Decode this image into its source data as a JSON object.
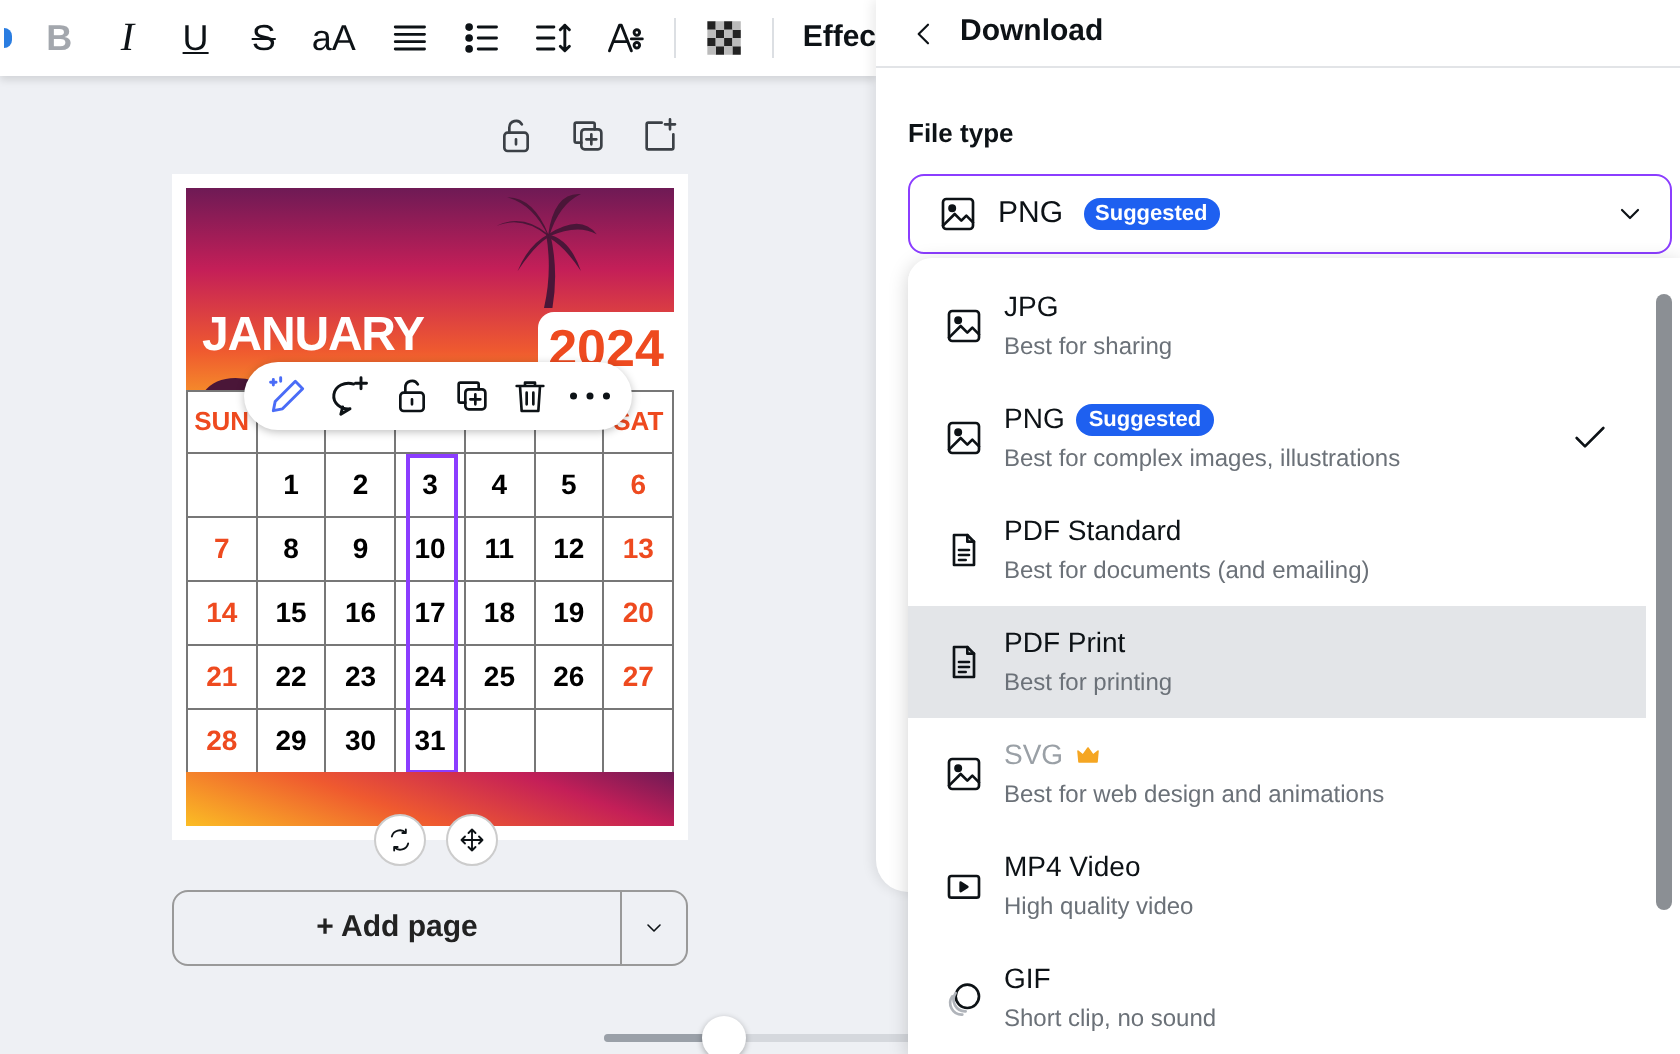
{
  "toolbar": {
    "items": [
      {
        "kind": "glyph",
        "text": "B",
        "disabled": true
      },
      {
        "kind": "glyph",
        "text": "I",
        "disabled": false
      },
      {
        "kind": "glyph",
        "text": "U",
        "disabled": false
      },
      {
        "kind": "glyph",
        "text": "S",
        "disabled": false
      },
      {
        "kind": "glyph",
        "text": "aA",
        "disabled": false
      },
      {
        "kind": "align"
      },
      {
        "kind": "list"
      },
      {
        "kind": "spacing"
      },
      {
        "kind": "textfx"
      },
      {
        "kind": "transparency"
      }
    ],
    "effects_label": "Effec"
  },
  "calendar": {
    "month": "JANUARY",
    "year": "2024",
    "headers": {
      "sun": "SUN",
      "sat": "SAT"
    },
    "weeks": [
      [
        {
          "kind": "blank"
        },
        {
          "kind": "weekday",
          "text": "1",
          "selected": false
        },
        {
          "kind": "weekday",
          "text": "2",
          "selected": false
        },
        {
          "kind": "weekday",
          "text": "3",
          "selected": true
        },
        {
          "kind": "weekday",
          "text": "4",
          "selected": false
        },
        {
          "kind": "weekday",
          "text": "5",
          "selected": false
        },
        {
          "kind": "weekend",
          "text": "6",
          "selected": false
        }
      ],
      [
        {
          "kind": "weekend",
          "text": "7",
          "selected": false
        },
        {
          "kind": "weekday",
          "text": "8",
          "selected": false
        },
        {
          "kind": "weekday",
          "text": "9",
          "selected": false
        },
        {
          "kind": "weekday",
          "text": "10",
          "selected": true
        },
        {
          "kind": "weekday",
          "text": "11",
          "selected": false
        },
        {
          "kind": "weekday",
          "text": "12",
          "selected": false
        },
        {
          "kind": "weekend",
          "text": "13",
          "selected": false
        }
      ],
      [
        {
          "kind": "weekend",
          "text": "14",
          "selected": false
        },
        {
          "kind": "weekday",
          "text": "15",
          "selected": false
        },
        {
          "kind": "weekday",
          "text": "16",
          "selected": false
        },
        {
          "kind": "weekday",
          "text": "17",
          "selected": true
        },
        {
          "kind": "weekday",
          "text": "18",
          "selected": false
        },
        {
          "kind": "weekday",
          "text": "19",
          "selected": false
        },
        {
          "kind": "weekend",
          "text": "20",
          "selected": false
        }
      ],
      [
        {
          "kind": "weekend",
          "text": "21",
          "selected": false
        },
        {
          "kind": "weekday",
          "text": "22",
          "selected": false
        },
        {
          "kind": "weekday",
          "text": "23",
          "selected": false
        },
        {
          "kind": "weekday",
          "text": "24",
          "selected": true
        },
        {
          "kind": "weekday",
          "text": "25",
          "selected": false
        },
        {
          "kind": "weekday",
          "text": "26",
          "selected": false
        },
        {
          "kind": "weekend",
          "text": "27",
          "selected": false
        }
      ],
      [
        {
          "kind": "weekend",
          "text": "28",
          "selected": false
        },
        {
          "kind": "weekday",
          "text": "29",
          "selected": false
        },
        {
          "kind": "weekday",
          "text": "30",
          "selected": false
        },
        {
          "kind": "weekday",
          "text": "31",
          "selected": true
        },
        {
          "kind": "blank"
        },
        {
          "kind": "blank"
        },
        {
          "kind": "blank"
        }
      ]
    ]
  },
  "add_page": {
    "label": "+ Add page"
  },
  "zoom_slider": {
    "level": 0.2
  },
  "panel": {
    "title": "Download",
    "file_type_label": "File type",
    "file_type": {
      "value": "PNG",
      "badge": "Suggested"
    },
    "options": [
      {
        "kind": "image",
        "label": "JPG",
        "description": "Best for sharing",
        "selected": false,
        "highlighted": false,
        "premium": false
      },
      {
        "kind": "image",
        "label": "PNG",
        "badge": "Suggested",
        "description": "Best for complex images, illustrations",
        "selected": true,
        "highlighted": false,
        "premium": false
      },
      {
        "kind": "document",
        "label": "PDF Standard",
        "description": "Best for documents (and emailing)",
        "selected": false,
        "highlighted": false,
        "premium": false
      },
      {
        "kind": "document",
        "label": "PDF Print",
        "description": "Best for printing",
        "selected": false,
        "highlighted": true,
        "premium": false
      },
      {
        "kind": "image",
        "label": "SVG",
        "description": "Best for web design and animations",
        "selected": false,
        "highlighted": false,
        "premium": true
      },
      {
        "kind": "video",
        "label": "MP4 Video",
        "description": "High quality video",
        "selected": false,
        "highlighted": false,
        "premium": false
      },
      {
        "kind": "animation",
        "label": "GIF",
        "description": "Short clip, no sound",
        "selected": false,
        "highlighted": false,
        "premium": false
      }
    ]
  }
}
